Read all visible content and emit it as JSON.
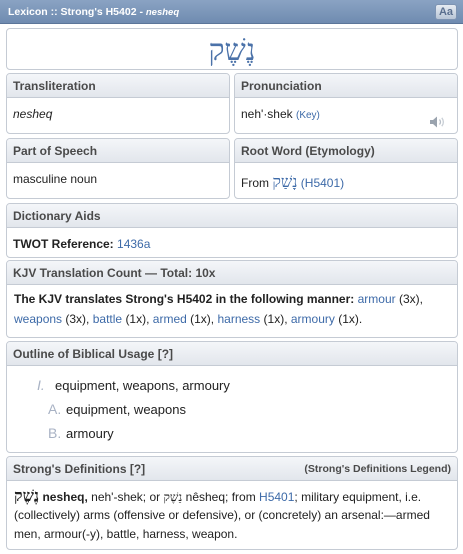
{
  "titlebar": {
    "prefix": "Lexicon :: Strong's H5402 - ",
    "entry": "nesheq",
    "font_button": "Aa"
  },
  "headword": {
    "hebrew": "נֶשֶׁק"
  },
  "transliteration": {
    "label": "Transliteration",
    "value": "nesheq"
  },
  "pronunciation": {
    "label": "Pronunciation",
    "value": "neh'·shek",
    "key_label": "(Key)",
    "icon": "speaker-icon"
  },
  "part_of_speech": {
    "label": "Part of Speech",
    "value": "masculine noun"
  },
  "root_word": {
    "label": "Root Word (Etymology)",
    "from": "From",
    "hebrew": "נָשַׁק",
    "ref": "(H5401)"
  },
  "dictionary_aids": {
    "label": "Dictionary Aids",
    "twot_label": "TWOT Reference:",
    "twot_value": "1436a"
  },
  "kjv": {
    "label": "KJV Translation Count — Total: 10x",
    "intro": "The KJV translates Strong's H5402 in the following manner:",
    "items": [
      {
        "word": "armour",
        "count": "(3x),"
      },
      {
        "word": "weapons",
        "count": "(3x),"
      },
      {
        "word": "battle",
        "count": "(1x),"
      },
      {
        "word": "armed",
        "count": "(1x),"
      },
      {
        "word": "harness",
        "count": "(1x),"
      },
      {
        "word": "armoury",
        "count": "(1x)."
      }
    ]
  },
  "outline": {
    "label": "Outline of Biblical Usage [?]",
    "items": [
      {
        "num": "I.",
        "text": "equipment, weapons, armoury"
      },
      {
        "num": "A.",
        "text": "equipment, weapons"
      },
      {
        "num": "B.",
        "text": "armoury"
      }
    ]
  },
  "strongs_def": {
    "label": "Strong's Definitions [?]",
    "legend": "(Strong's Definitions Legend)",
    "hebrew": "נֶשֶׁק",
    "bold_word": "nesheq,",
    "line1_a": "neh'-shek; or",
    "hebrew2": "נֵשֶׁק",
    "line1_b": "nêsheq; from",
    "ref": "H5401",
    "line1_c": "; military equipment, i.e.",
    "line2": "(collectively) arms (offensive or defensive), or (concretely) an arsenal:—armed",
    "line3": "men, armour(-y), battle, harness, weapon."
  },
  "colors": {
    "accent": "#3d6aa8",
    "titlebar": "#7a94b7",
    "outline_numerals": "#a8b2c4"
  }
}
